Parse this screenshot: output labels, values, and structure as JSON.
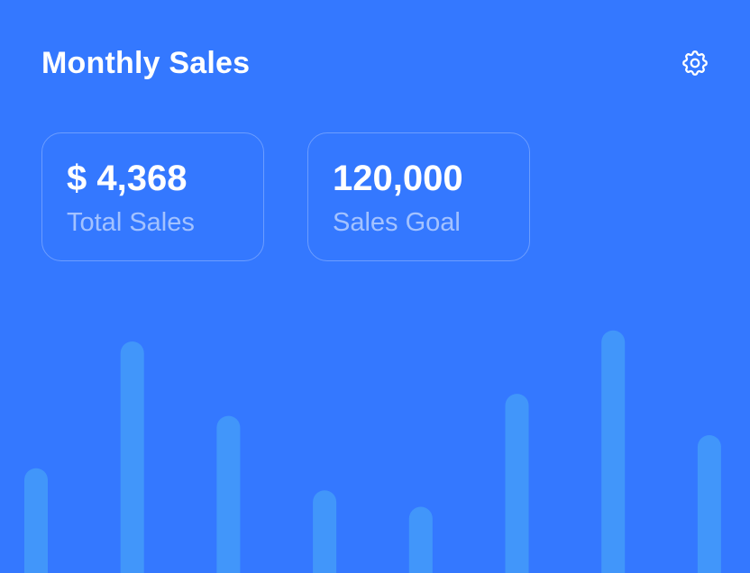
{
  "card": {
    "title": "Monthly Sales"
  },
  "icons": {
    "settings": "gear-icon"
  },
  "stats": [
    {
      "value": "$ 4,368",
      "label": "Total Sales"
    },
    {
      "value": "120,000",
      "label": "Sales Goal"
    }
  ],
  "colors": {
    "background": "#3478ff",
    "bar": "#4196fa",
    "text": "#ffffff"
  },
  "chart_data": {
    "type": "bar",
    "values": [
      0.38,
      0.84,
      0.57,
      0.3,
      0.24,
      0.65,
      0.88,
      0.5
    ],
    "grid": false,
    "legend": "none"
  }
}
